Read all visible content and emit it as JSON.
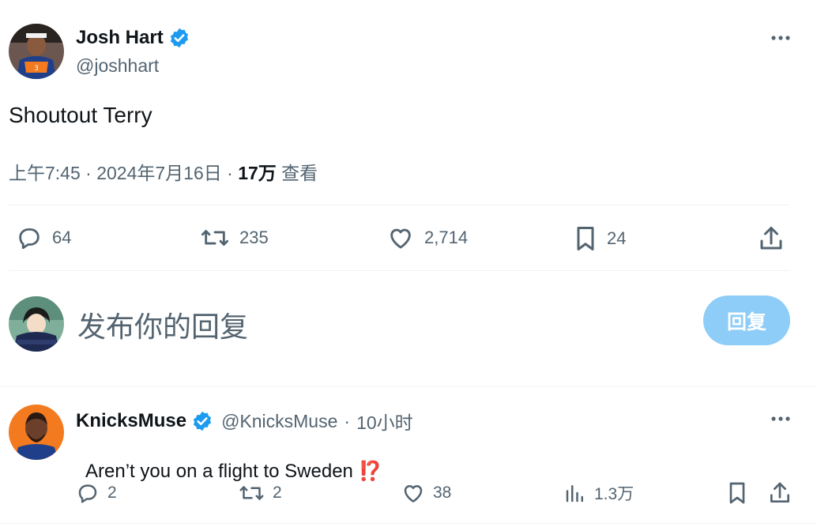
{
  "tweet": {
    "author_name": "Josh Hart",
    "author_handle": "@joshhart",
    "text": "Shoutout Terry",
    "meta_time": "上午7:45 · 2024年7月16日 · ",
    "meta_views_count": "17万",
    "meta_views_label": " 查看",
    "actions": {
      "replies": "64",
      "retweets": "235",
      "likes": "2,714",
      "bookmarks": "24"
    }
  },
  "compose": {
    "placeholder": "发布你的回复",
    "reply_button": "回复"
  },
  "reply": {
    "author_name": "KnicksMuse",
    "author_handle": "@KnicksMuse",
    "separator": "·",
    "time": "10小时",
    "text": "Aren’t you on a flight to Sweden ",
    "emoji": "⁉️",
    "actions": {
      "replies": "2",
      "retweets": "2",
      "likes": "38",
      "views": "1.3万"
    }
  },
  "colors": {
    "verified_blue": "#1d9bf0",
    "reply_button_disabled": "#8ecdf7",
    "text_secondary": "#536471",
    "text_primary": "#0f1419"
  }
}
